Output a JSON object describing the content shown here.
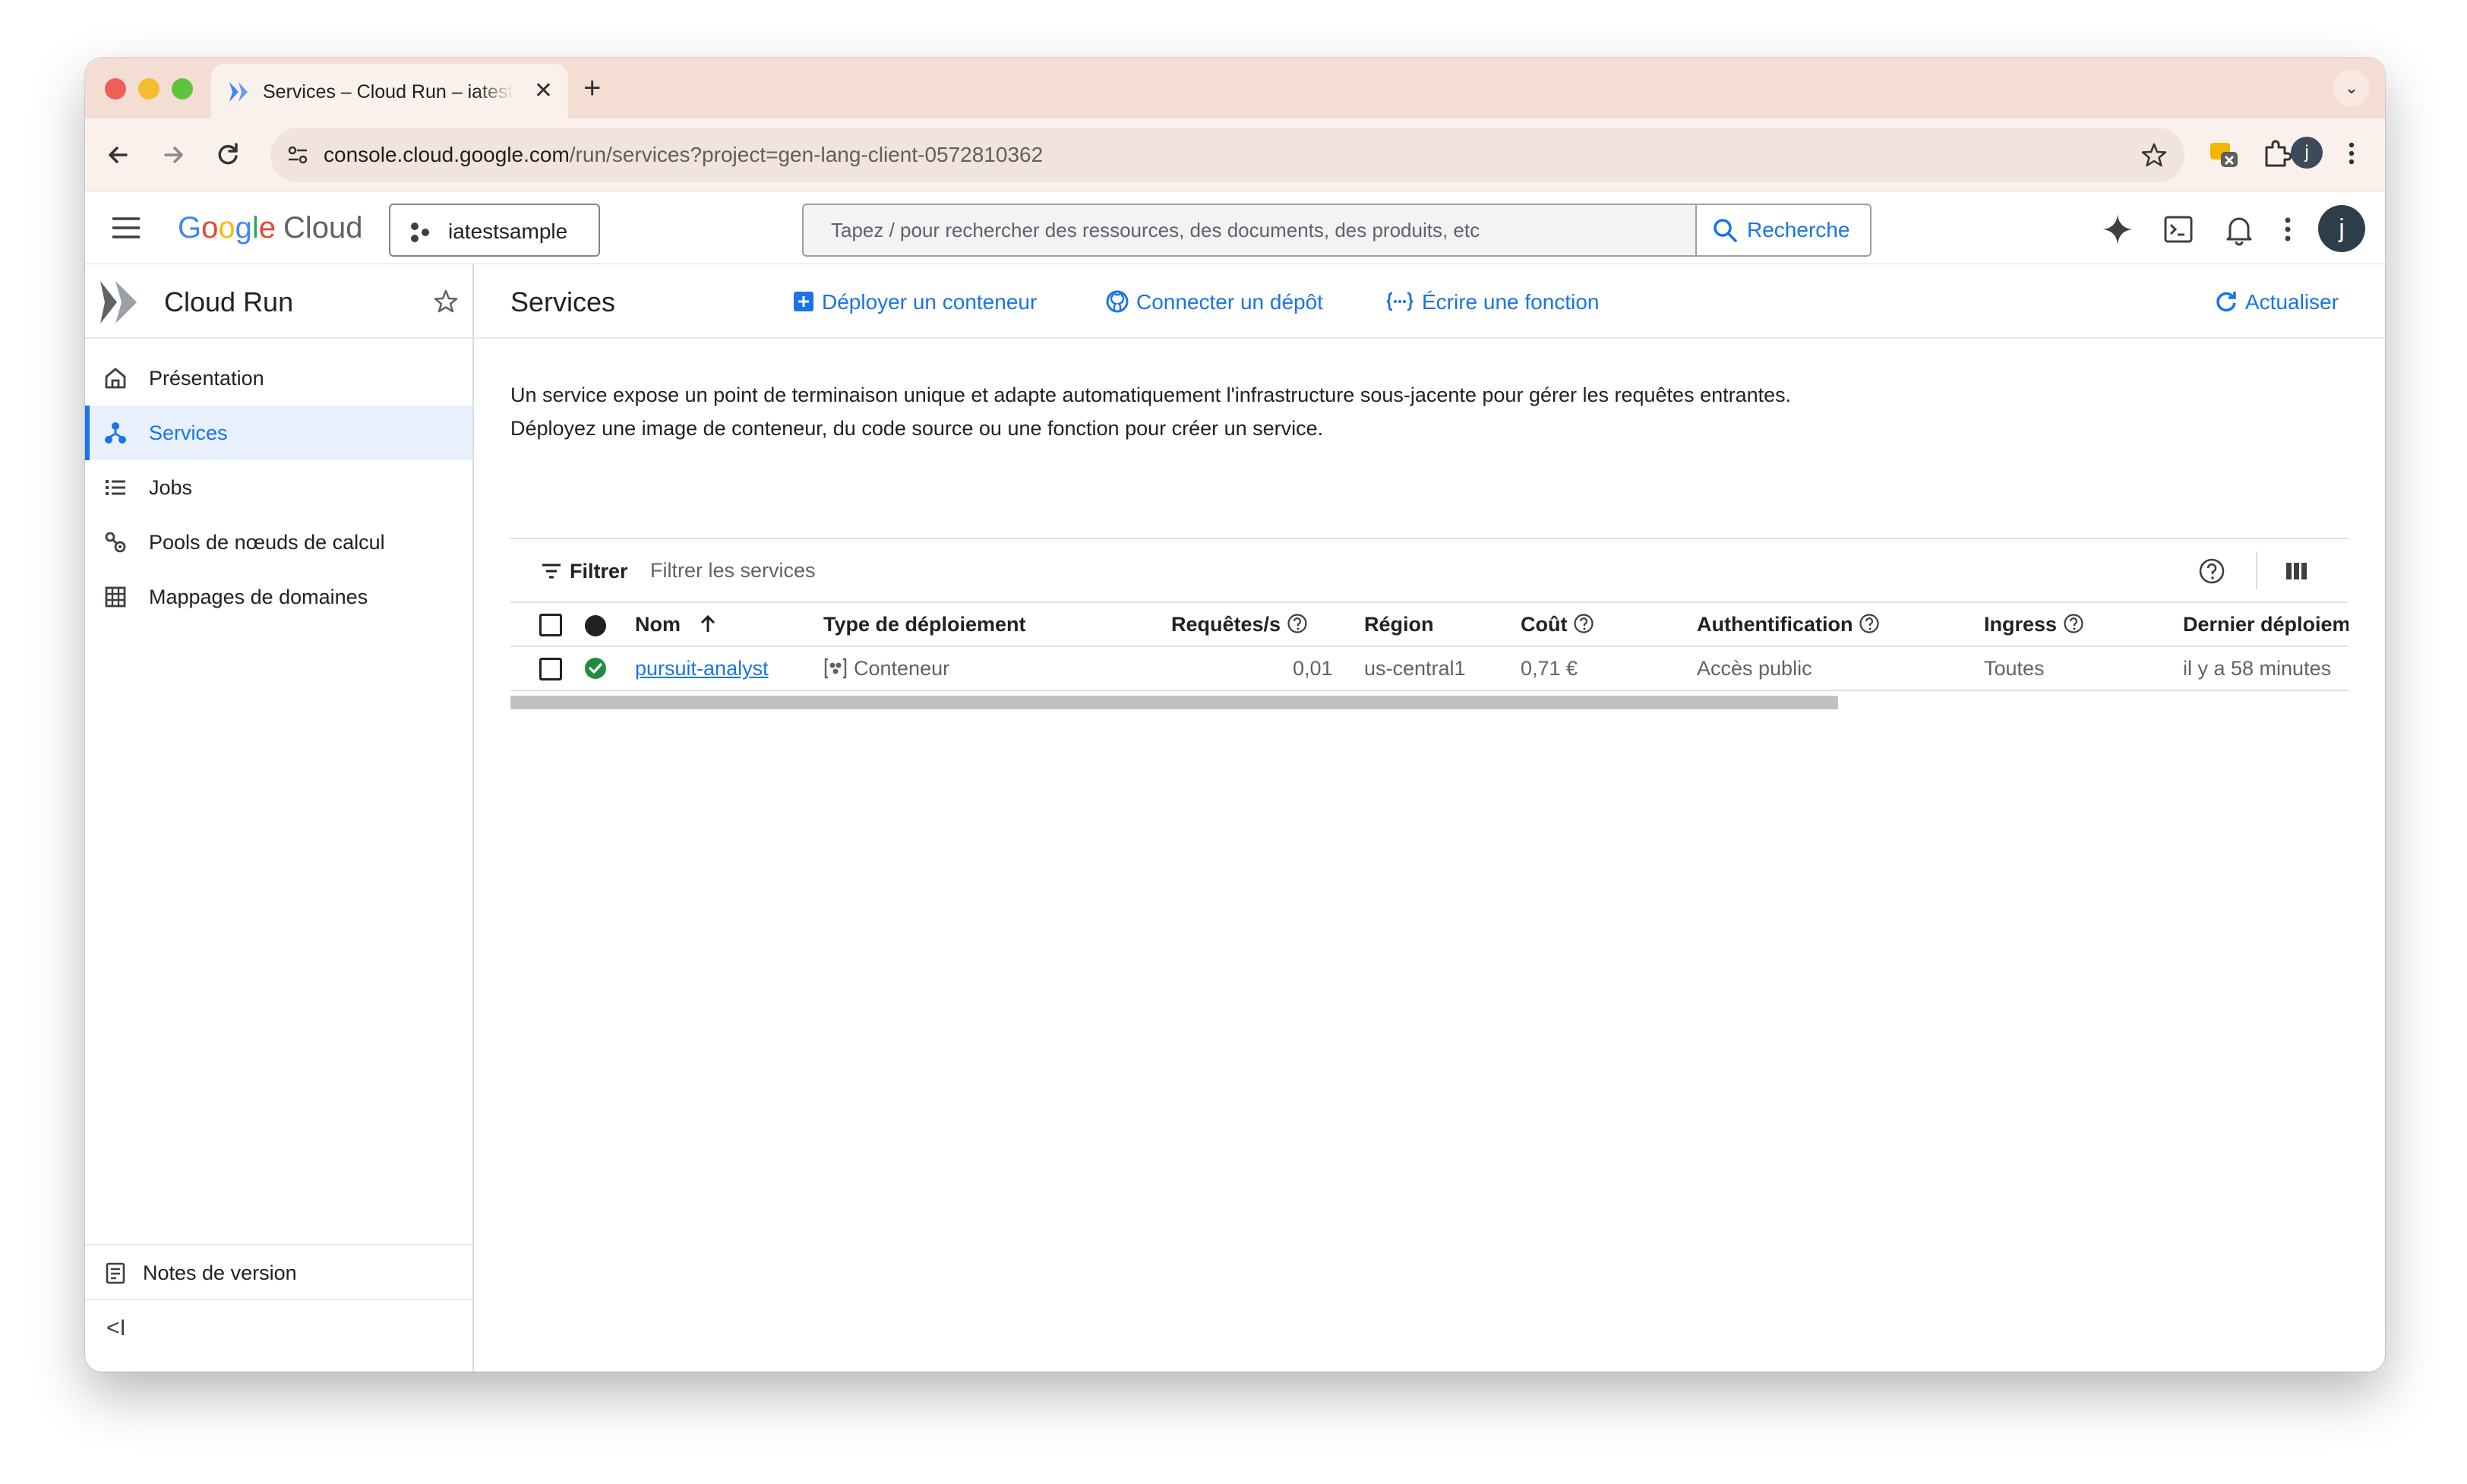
{
  "browser": {
    "tab_title": "Services – Cloud Run – iatestsample",
    "new_tab_label": "+",
    "close_tab_label": "✕",
    "url_host": "console.cloud.google.com",
    "url_path": "/run/services?project=gen-lang-client-0572810362",
    "profile_initial": "j"
  },
  "header": {
    "logo_google": [
      "G",
      "o",
      "o",
      "g",
      "l",
      "e"
    ],
    "logo_cloud": "Cloud",
    "project_name": "iatestsample",
    "search_placeholder": "Tapez / pour rechercher des ressources, des documents, des produits, etc",
    "search_button": "Recherche",
    "avatar_initial": "j"
  },
  "sidebar": {
    "product_name": "Cloud Run",
    "items": [
      {
        "label": "Présentation",
        "icon": "home-icon"
      },
      {
        "label": "Services",
        "icon": "services-icon",
        "active": true
      },
      {
        "label": "Jobs",
        "icon": "list-icon"
      },
      {
        "label": "Pools de nœuds de calcul",
        "icon": "worker-pool-icon"
      },
      {
        "label": "Mappages de domaines",
        "icon": "domain-icon"
      }
    ],
    "release_notes": "Notes de version",
    "collapse_label": "<I"
  },
  "main": {
    "title": "Services",
    "actions": {
      "deploy": "Déployer un conteneur",
      "connect": "Connecter un dépôt",
      "write": "Écrire une fonction",
      "refresh": "Actualiser"
    },
    "description_line1": "Un service expose un point de terminaison unique et adapte automatiquement l'infrastructure sous-jacente pour gérer les requêtes entrantes.",
    "description_line2": "Déployez une image de conteneur, du code source ou une fonction pour créer un service.",
    "filter_label": "Filtrer",
    "filter_placeholder": "Filtrer les services",
    "columns": {
      "name": "Nom",
      "deployment_type": "Type de déploiement",
      "requests": "Requêtes/s",
      "region": "Région",
      "cost": "Coût",
      "auth": "Authentification",
      "ingress": "Ingress",
      "last_deployed": "Dernier déploiement"
    },
    "rows": [
      {
        "name": "pursuit-analyst",
        "status": "ok",
        "deployment_type": "Conteneur",
        "requests": "0,01",
        "region": "us-central1",
        "cost": "0,71 €",
        "auth": "Accès public",
        "ingress": "Toutes",
        "last_deployed": "il y a 58 minutes"
      }
    ]
  },
  "colors": {
    "accent": "#1a73e8",
    "active_nav_bg": "#e8f0fe",
    "status_ok": "#1e8e3e",
    "tab_bar": "#f4ddd3"
  }
}
